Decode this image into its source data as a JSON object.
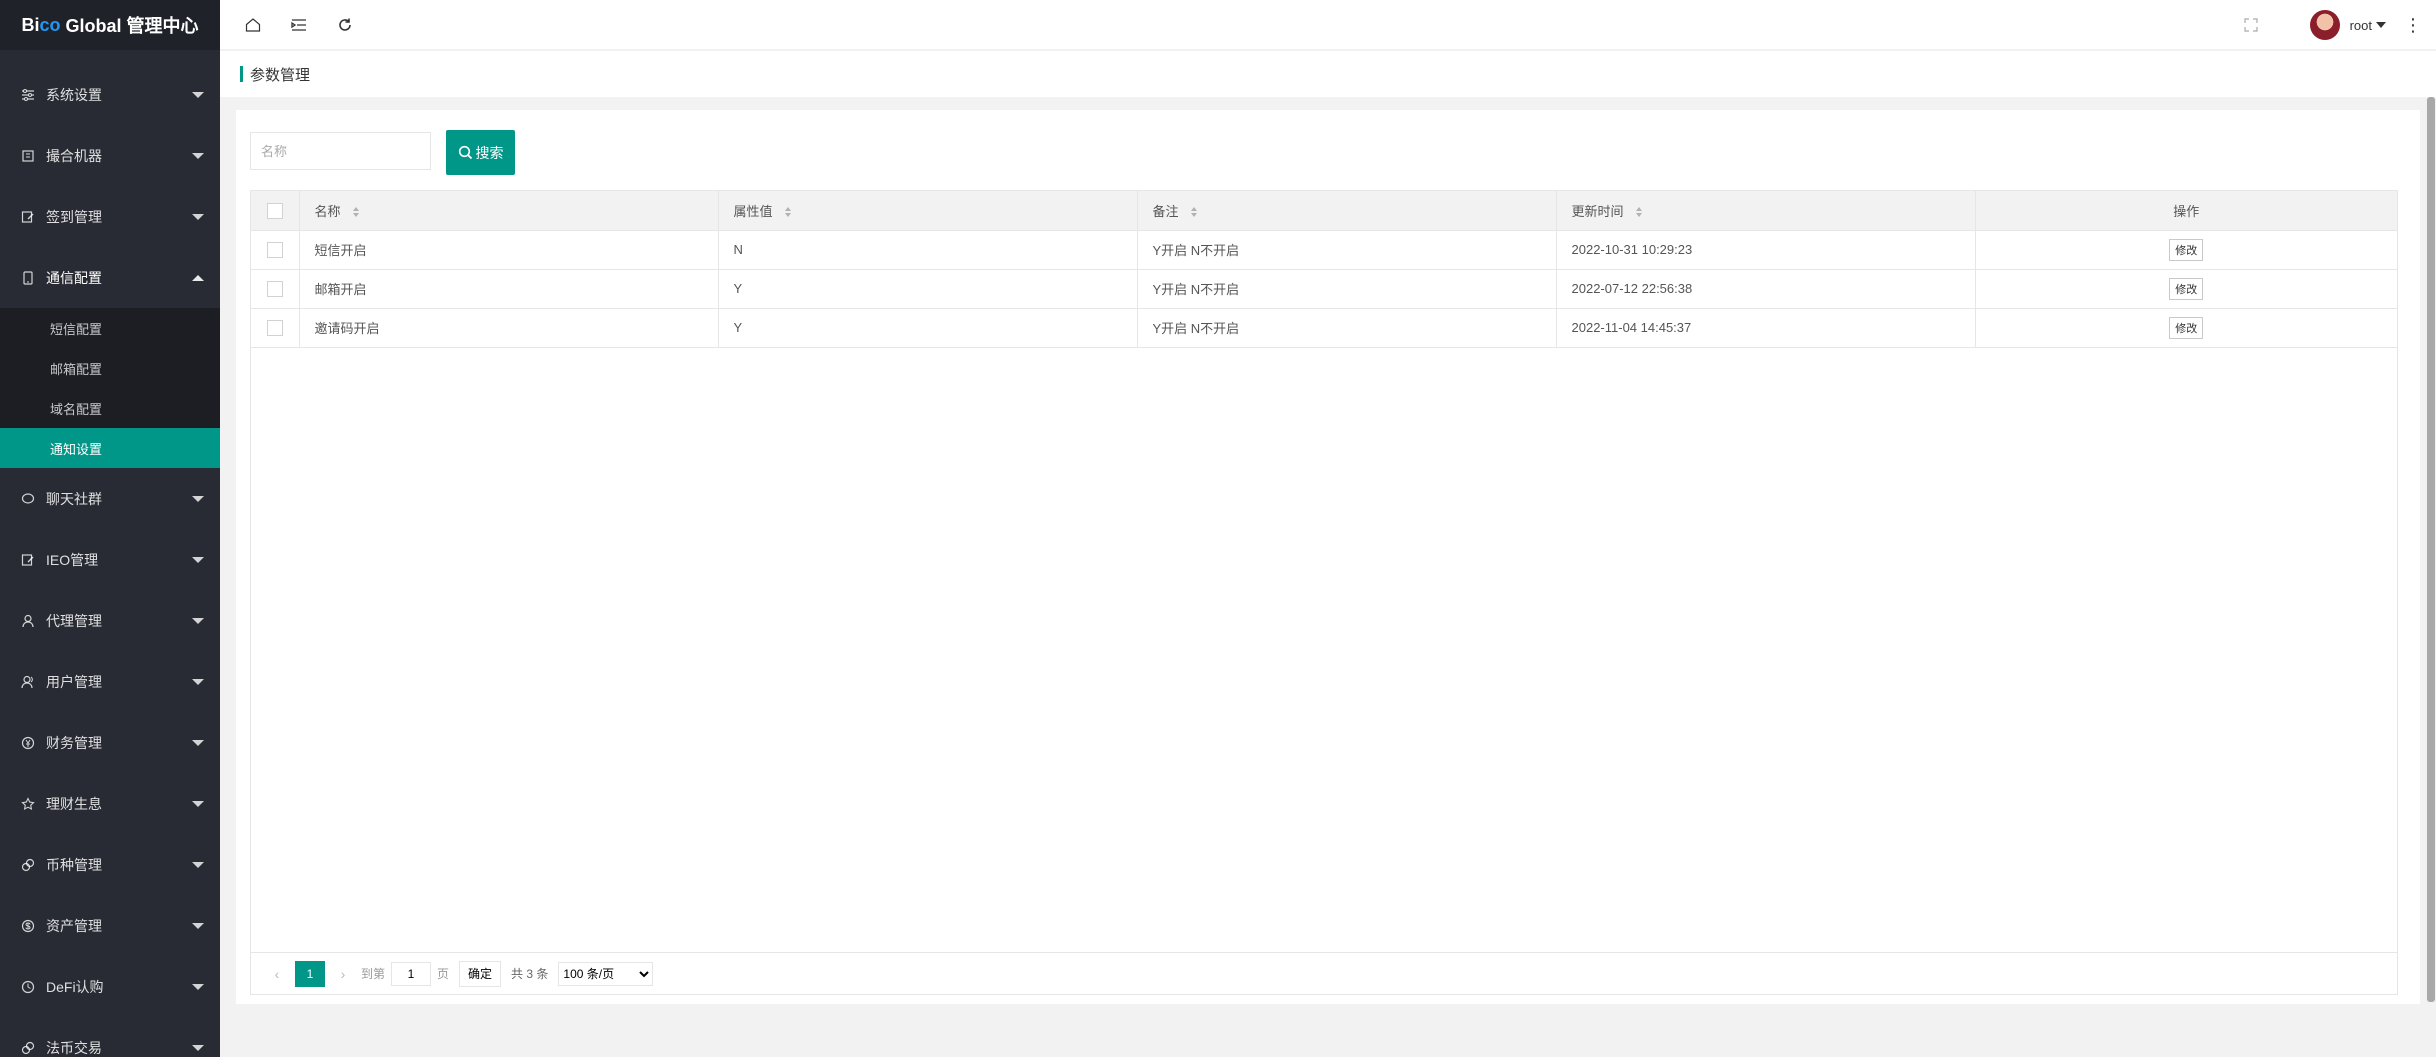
{
  "app": {
    "logo_prefix": "Bi",
    "logo_accent": "co",
    "logo_suffix": " Global 管理中心"
  },
  "sidebar": {
    "items": [
      {
        "label": "系统设置",
        "icon": "sliders-icon"
      },
      {
        "label": "撮合机器",
        "icon": "robot-icon"
      },
      {
        "label": "签到管理",
        "icon": "edit-icon"
      },
      {
        "label": "通信配置",
        "icon": "phone-icon",
        "open": true
      },
      {
        "label": "聊天社群",
        "icon": "chat-icon"
      },
      {
        "label": "IEO管理",
        "icon": "edit-icon"
      },
      {
        "label": "代理管理",
        "icon": "user-icon"
      },
      {
        "label": "用户管理",
        "icon": "users-icon"
      },
      {
        "label": "财务管理",
        "icon": "yen-icon"
      },
      {
        "label": "理财生息",
        "icon": "star-icon"
      },
      {
        "label": "币种管理",
        "icon": "coins-icon"
      },
      {
        "label": "资产管理",
        "icon": "dollar-icon"
      },
      {
        "label": "DeFi认购",
        "icon": "clock-icon"
      },
      {
        "label": "法币交易",
        "icon": "coins-icon"
      }
    ],
    "submenu": [
      {
        "label": "短信配置"
      },
      {
        "label": "邮箱配置"
      },
      {
        "label": "域名配置"
      },
      {
        "label": "通知设置",
        "active": true
      }
    ]
  },
  "header": {
    "user": "root"
  },
  "breadcrumb": {
    "title": "参数管理"
  },
  "search": {
    "placeholder": "名称",
    "button_label": "搜索"
  },
  "table": {
    "columns": [
      "名称",
      "属性值",
      "备注",
      "更新时间",
      "操作"
    ],
    "rows": [
      {
        "name": "短信开启",
        "value": "N",
        "remark": "Y开启 N不开启",
        "updated": "2022-10-31 10:29:23",
        "action": "修改"
      },
      {
        "name": "邮箱开启",
        "value": "Y",
        "remark": "Y开启 N不开启",
        "updated": "2022-07-12 22:56:38",
        "action": "修改"
      },
      {
        "name": "邀请码开启",
        "value": "Y",
        "remark": "Y开启 N不开启",
        "updated": "2022-11-04 14:45:37",
        "action": "修改"
      }
    ]
  },
  "pager": {
    "current": "1",
    "goto_label": "到第",
    "goto_value": "1",
    "page_label": "页",
    "confirm_label": "确定",
    "total_label": "共 3 条",
    "page_size": "100 条/页"
  },
  "colors": {
    "accent": "#009688",
    "sidebar_bg": "#282b33"
  }
}
